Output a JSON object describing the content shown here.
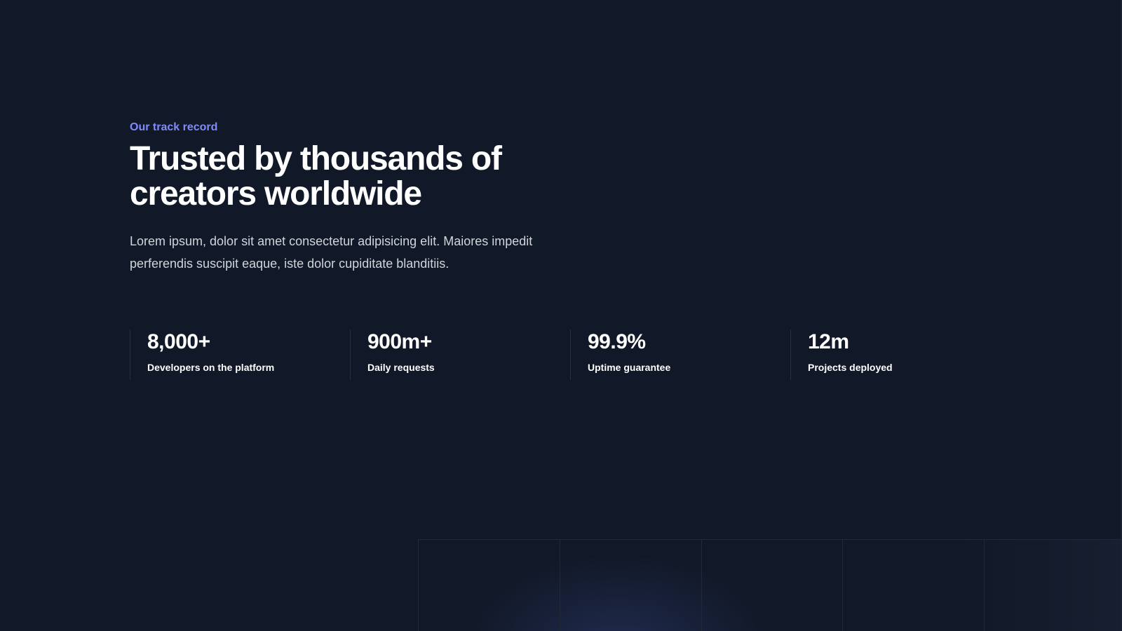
{
  "section": {
    "eyebrow": "Our track record",
    "headline": "Trusted by thousands of creators worldwide",
    "lead": "Lorem ipsum, dolor sit amet consectetur adipisicing elit. Maiores impedit perferendis suscipit eaque, iste dolor cupiditate blanditiis."
  },
  "stats": [
    {
      "value": "8,000+",
      "label": "Developers on the platform"
    },
    {
      "value": "900m+",
      "label": "Daily requests"
    },
    {
      "value": "99.9%",
      "label": "Uptime guarantee"
    },
    {
      "value": "12m",
      "label": "Projects deployed"
    }
  ],
  "colors": {
    "background": "#111827",
    "accent": "#818cf8",
    "text": "#ffffff",
    "muted_text": "#d1d5db",
    "divider": "#263040"
  }
}
